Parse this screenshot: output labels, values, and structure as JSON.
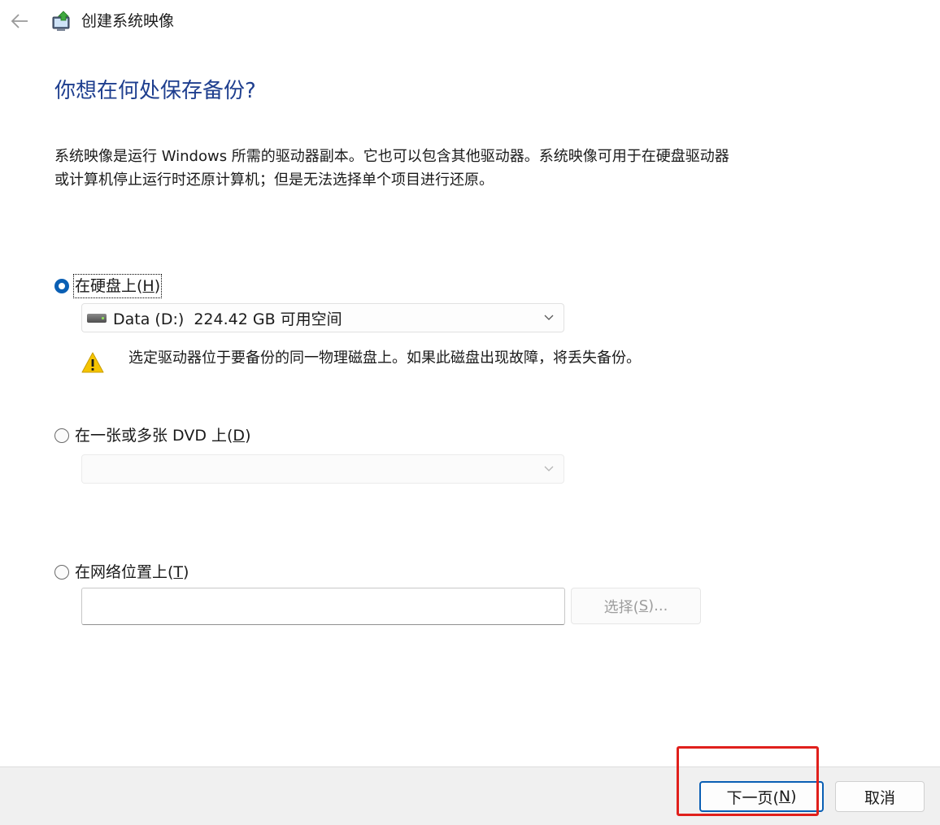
{
  "window": {
    "title": "创建系统映像"
  },
  "page": {
    "heading": "你想在何处保存备份?",
    "description_line1": "系统映像是运行 Windows 所需的驱动器副本。它也可以包含其他驱动器。系统映像可用于在硬盘驱动器",
    "description_line2": "或计算机停止运行时还原计算机；但是无法选择单个项目进行还原。"
  },
  "options": {
    "hard_disk": {
      "label_prefix": "在硬盘上(",
      "accel": "H",
      "label_suffix": ")",
      "selected": true,
      "drive_value": "Data (D:)  224.42 GB 可用空间",
      "warning": "选定驱动器位于要备份的同一物理磁盘上。如果此磁盘出现故障，将丢失备份。"
    },
    "dvd": {
      "label_prefix": "在一张或多张 DVD 上(",
      "accel": "D",
      "label_suffix": ")",
      "selected": false,
      "drive_value": ""
    },
    "network": {
      "label_prefix": "在网络位置上(",
      "accel": "T",
      "label_suffix": ")",
      "selected": false,
      "path_value": "",
      "browse_prefix": "选择(",
      "browse_accel": "S",
      "browse_suffix": ")..."
    }
  },
  "footer": {
    "next_prefix": "下一页(",
    "next_accel": "N",
    "next_suffix": ")",
    "cancel_label": "取消"
  },
  "colors": {
    "heading": "#1f3f8f",
    "accent": "#0a5fb4",
    "highlight": "#e0201c"
  },
  "icons": {
    "back": "arrow-left-icon",
    "app": "system-image-backup-icon",
    "drive": "hard-drive-icon",
    "warning": "warning-triangle-icon",
    "chevron": "chevron-down-icon"
  }
}
